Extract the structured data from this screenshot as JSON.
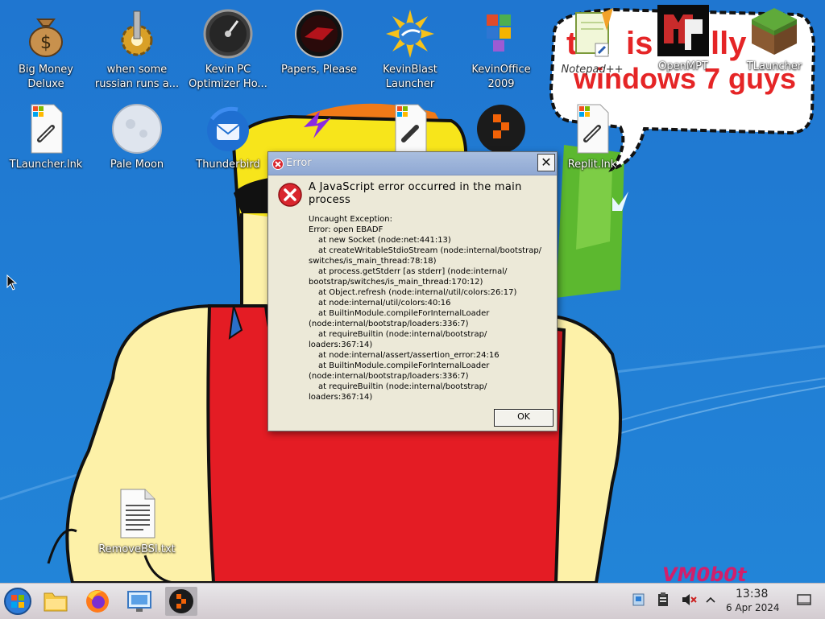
{
  "desktop": {
    "icons": [
      {
        "label": "Big Money\nDeluxe",
        "icon": "money-bag-icon"
      },
      {
        "label": "when some\nrussian runs a...",
        "icon": "gear-icon"
      },
      {
        "label": "Kevin PC\nOptimizer Ho...",
        "icon": "speedometer-icon"
      },
      {
        "label": "Papers, Please",
        "icon": "papers-please-icon"
      },
      {
        "label": "KevinBlast\nLauncher",
        "icon": "sun-globe-icon"
      },
      {
        "label": "KevinOffice\n2009",
        "icon": "office-icon"
      },
      {
        "label": "Notepad++",
        "icon": "notepad-icon"
      },
      {
        "label": "OpenMPT",
        "icon": "openmpt-icon"
      },
      {
        "label": "TLauncher",
        "icon": "grass-block-icon"
      },
      {
        "label": "TLauncher.lnk",
        "icon": "shortcut-file-icon"
      },
      {
        "label": "Pale Moon",
        "icon": "moon-icon"
      },
      {
        "label": "Thunderbird",
        "icon": "thunderbird-icon"
      },
      {
        "label": "Replit.lnk",
        "icon": "shortcut-file-icon"
      },
      {
        "label": "RemoveBSI.txt",
        "icon": "text-file-icon"
      }
    ],
    "wallpaper_text_line1_a": "th",
    "wallpaper_text_line1_b": "is",
    "wallpaper_text_line1_c": "lly",
    "wallpaper_text_line2": "windows 7 guys",
    "watermark": "VM0b0t"
  },
  "dialog": {
    "title": "Error",
    "heading": "A JavaScript error occurred in the main process",
    "body_lines": [
      "Uncaught Exception:",
      "Error: open EBADF",
      "    at new Socket (node:net:441:13)",
      "    at createWritableStdioStream (node:internal/bootstrap/",
      "switches/is_main_thread:78:18)",
      "    at process.getStderr [as stderr] (node:internal/",
      "bootstrap/switches/is_main_thread:170:12)",
      "    at Object.refresh (node:internal/util/colors:26:17)",
      "    at node:internal/util/colors:40:16",
      "    at BuiltinModule.compileForInternalLoader",
      "(node:internal/bootstrap/loaders:336:7)",
      "    at requireBuiltin (node:internal/bootstrap/",
      "loaders:367:14)",
      "    at node:internal/assert/assertion_error:24:16",
      "    at BuiltinModule.compileForInternalLoader",
      "(node:internal/bootstrap/loaders:336:7)",
      "    at requireBuiltin (node:internal/bootstrap/",
      "loaders:367:14)"
    ],
    "ok_label": "OK",
    "close_label": "✕"
  },
  "taskbar": {
    "items": [
      "start-orb-icon",
      "file-explorer-icon",
      "firefox-icon",
      "remote-desktop-icon",
      "replit-icon"
    ],
    "tray": [
      "network-icon",
      "clipboard-icon",
      "volume-muted-icon",
      "chevron-up-icon"
    ],
    "time": "13:38",
    "date": "6 Apr 2024"
  },
  "colors": {
    "error_red": "#d9262e",
    "title_bar": "#9bb3da",
    "dialog_bg": "#ece9d8",
    "taskbar": "#ddd6da"
  }
}
